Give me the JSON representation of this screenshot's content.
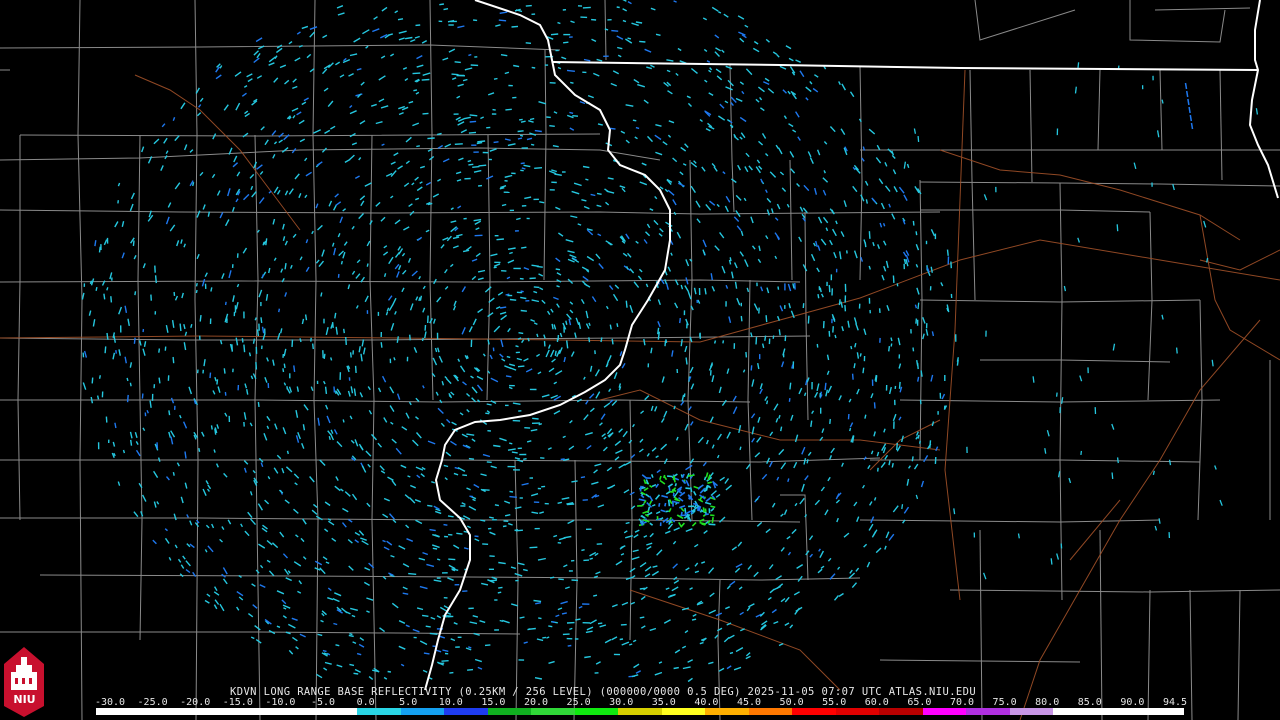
{
  "product_title": "KDVN LONG RANGE BASE REFLECTIVITY (0.25KM / 256 LEVEL) (000000/0000 0.5 DEG) 2025-11-05 07:07 UTC  ATLAS.NIU.EDU",
  "logo_text": "NIU",
  "scale_labels": [
    "-30.0",
    "-25.0",
    "-20.0",
    "-15.0",
    "-10.0",
    "-5.0",
    "0.0",
    "5.0",
    "10.0",
    "15.0",
    "20.0",
    "25.0",
    "30.0",
    "35.0",
    "40.0",
    "45.0",
    "50.0",
    "55.0",
    "60.0",
    "65.0",
    "70.0",
    "75.0",
    "80.0",
    "85.0",
    "90.0",
    "94.5"
  ],
  "color_bar": [
    "#ffffff",
    "#ffffff",
    "#ffffff",
    "#ffffff",
    "#ffffff",
    "#ffffff",
    "#2ad6e6",
    "#14a0f0",
    "#1e3cf0",
    "#10b020",
    "#30d838",
    "#10ea10",
    "#d6d000",
    "#ffff20",
    "#ffb000",
    "#ff7800",
    "#ff0000",
    "#e00000",
    "#b80000",
    "#ff00ff",
    "#b030e0",
    "#c896e6",
    "#ffffff",
    "#ffffff",
    "#ffffff"
  ],
  "colors": {
    "background": "#000000",
    "county_lines": "#8a8a8a",
    "state_lines": "#ffffff",
    "roads": "#a05028",
    "echo_cyan": "#25c8e0",
    "echo_blue": "#1e78f0",
    "echo_green": "#20e020"
  }
}
